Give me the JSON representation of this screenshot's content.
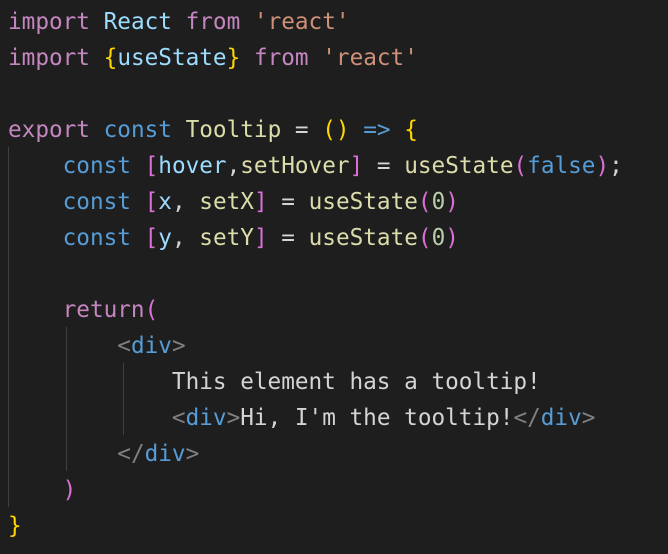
{
  "editor": {
    "language": "javascript-react",
    "theme": "dark",
    "colors": {
      "background": "#1e1e1e",
      "keyword_control": "#c586c0",
      "string": "#ce9178",
      "storage_keyword": "#569cd6",
      "variable": "#9cdcfe",
      "function": "#dcdcaa",
      "number": "#b5cea8",
      "text": "#d4d4d4",
      "jsx_bracket": "#808080",
      "bracket_level_1": "#ffd700",
      "bracket_level_2": "#da70d6",
      "bracket_level_3": "#179fff"
    },
    "code": {
      "l1": {
        "import": "import",
        "react": "React",
        "from": "from",
        "src": "'react'"
      },
      "l2": {
        "import": "import",
        "open": "{",
        "name": "useState",
        "close": "}",
        "from": "from",
        "src": "'react'"
      },
      "l4": {
        "export": "export",
        "const": "const",
        "name": "Tooltip",
        "eq": "=",
        "open": "(",
        "close": ")",
        "arrow": "=>",
        "brace": "{"
      },
      "l5": {
        "const": "const",
        "open": "[",
        "a": "hover",
        "comma": ",",
        "b": "setHover",
        "close": "]",
        "eq": "=",
        "fn": "useState",
        "popen": "(",
        "val": "false",
        "pclose": ")",
        "end": ";"
      },
      "l6": {
        "const": "const",
        "open": "[",
        "a": "x",
        "comma": ",",
        "b": "setX",
        "close": "]",
        "eq": "=",
        "fn": "useState",
        "popen": "(",
        "val": "0",
        "pclose": ")"
      },
      "l7": {
        "const": "const",
        "open": "[",
        "a": "y",
        "comma": ",",
        "b": "setY",
        "close": "]",
        "eq": "=",
        "fn": "useState",
        "popen": "(",
        "val": "0",
        "pclose": ")"
      },
      "l9": {
        "ret": "return",
        "open": "("
      },
      "l10": {
        "lt": "<",
        "tag": "div",
        "gt": ">"
      },
      "l11": {
        "text": "This element has a tooltip!"
      },
      "l12": {
        "lt": "<",
        "tag": "div",
        "gt": ">",
        "text": "Hi, I'm the tooltip!",
        "clt": "</",
        "ctag": "div",
        "cgt": ">"
      },
      "l13": {
        "clt": "</",
        "tag": "div",
        "gt": ">"
      },
      "l14": {
        "close": ")"
      },
      "l15": {
        "brace": "}"
      }
    }
  }
}
